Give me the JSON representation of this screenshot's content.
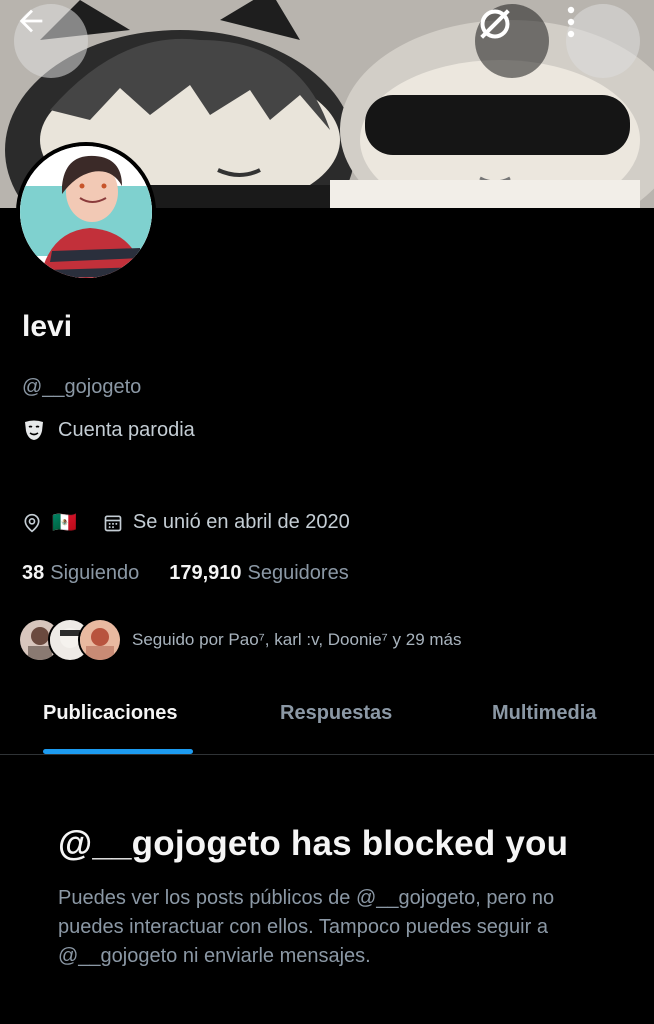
{
  "profile": {
    "name": "levi",
    "handle": "@__gojogeto",
    "parody_label": "Cuenta parodia",
    "location_flag": "🇲🇽",
    "joined": "Se unió en abril de 2020",
    "following_count": "38",
    "following_label": "Siguiendo",
    "followers_count": "179,910",
    "followers_label": "Seguidores",
    "followed_by": "Seguido por Pao⁷, karl :v, Doonie⁷ y 29 más"
  },
  "header": {
    "icons": [
      "back-arrow-icon",
      "sync-off-icon",
      "more-vertical-icon"
    ]
  },
  "tabs": [
    {
      "label": "Publicaciones",
      "active": true
    },
    {
      "label": "Respuestas",
      "active": false
    },
    {
      "label": "Multimedia",
      "active": false
    }
  ],
  "blocked": {
    "title": "@__gojogeto has blocked you",
    "body": "Puedes ver los posts públicos de @__gojogeto, pero no puedes interactuar con ellos. Tampoco puedes seguir a @__gojogeto ni enviarle mensajes."
  },
  "colors": {
    "accent": "#1d9bf0",
    "background": "#000000",
    "secondary_text": "#8b98a5"
  }
}
